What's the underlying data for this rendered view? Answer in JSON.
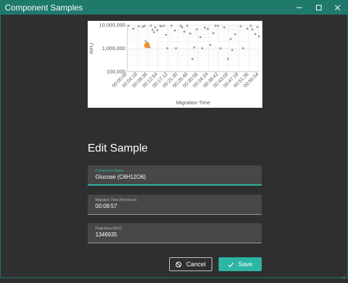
{
  "window": {
    "title": "Component Samples",
    "controls": {
      "minimize_icon": "minimize-icon",
      "maximize_icon": "maximize-icon",
      "close_icon": "close-icon"
    }
  },
  "chart_data": {
    "type": "scatter",
    "ylabel": "RFU",
    "xlabel": "Migration Time",
    "y_scale": "log",
    "ylim": [
      100,
      10000000
    ],
    "y_ticks": [
      "10,000,000",
      "1,000,000",
      "100,000"
    ],
    "x_ticks": [
      "00:00:00",
      "00:04:18",
      "00:08:36",
      "00:12:54",
      "00:17:12",
      "00:21:30",
      "00:25:48",
      "00:30:06",
      "00:34:24",
      "00:38:42",
      "00:43:00",
      "00:47:18",
      "00:51:36",
      "00:55:54"
    ],
    "xlim_seconds": [
      0,
      3600
    ],
    "grid": true,
    "series": [
      {
        "color": "#9e9e9e",
        "points": [
          {
            "x": 30,
            "y": 9800000
          },
          {
            "x": 160,
            "y": 6900000
          },
          {
            "x": 310,
            "y": 8900000
          },
          {
            "x": 420,
            "y": 8500000
          },
          {
            "x": 470,
            "y": 9200000
          },
          {
            "x": 500,
            "y": 2000000
          },
          {
            "x": 560,
            "y": 1700000
          },
          {
            "x": 610,
            "y": 1100000
          },
          {
            "x": 640,
            "y": 9400000
          },
          {
            "x": 690,
            "y": 6200000
          },
          {
            "x": 730,
            "y": 4900000
          },
          {
            "x": 760,
            "y": 8100000
          },
          {
            "x": 820,
            "y": 6000000
          },
          {
            "x": 900,
            "y": 10500000
          },
          {
            "x": 930,
            "y": 8800000
          },
          {
            "x": 1000,
            "y": 11000000
          },
          {
            "x": 1060,
            "y": 3800000
          },
          {
            "x": 1090,
            "y": 1000000
          },
          {
            "x": 1210,
            "y": 9700000
          },
          {
            "x": 1300,
            "y": 5800000
          },
          {
            "x": 1330,
            "y": 1000000
          },
          {
            "x": 1460,
            "y": 10700000
          },
          {
            "x": 1500,
            "y": 8000000
          },
          {
            "x": 1560,
            "y": 5200000
          },
          {
            "x": 1640,
            "y": 10000000
          },
          {
            "x": 1720,
            "y": 4300000
          },
          {
            "x": 1780,
            "y": 350000
          },
          {
            "x": 1830,
            "y": 1100000
          },
          {
            "x": 1900,
            "y": 6500000
          },
          {
            "x": 2000,
            "y": 3000000
          },
          {
            "x": 2050,
            "y": 1000000
          },
          {
            "x": 2120,
            "y": 7700000
          },
          {
            "x": 2200,
            "y": 6800000
          },
          {
            "x": 2270,
            "y": 1400000
          },
          {
            "x": 2350,
            "y": 4500000
          },
          {
            "x": 2410,
            "y": 10500000
          },
          {
            "x": 2480,
            "y": 9500000
          },
          {
            "x": 2550,
            "y": 1000000
          },
          {
            "x": 2650,
            "y": 8000000
          },
          {
            "x": 2750,
            "y": 350000
          },
          {
            "x": 2830,
            "y": 2500000
          },
          {
            "x": 2870,
            "y": 850000
          },
          {
            "x": 2950,
            "y": 4000000
          },
          {
            "x": 3100,
            "y": 8800000
          },
          {
            "x": 3170,
            "y": 1000000
          },
          {
            "x": 3280,
            "y": 7000000
          },
          {
            "x": 3380,
            "y": 10000000
          },
          {
            "x": 3420,
            "y": 6500000
          },
          {
            "x": 3500,
            "y": 4100000
          },
          {
            "x": 3560,
            "y": 8200000
          },
          {
            "x": 3600,
            "y": 3300000
          }
        ]
      },
      {
        "color": "#f28c1e",
        "highlighted": true,
        "points": [
          {
            "x": 537,
            "y": 1346935
          }
        ]
      }
    ]
  },
  "dialog": {
    "title": "Edit Sample",
    "fields": [
      {
        "label": "Component Name",
        "value": "Glucose (C6H12O6)"
      },
      {
        "label": "Migration Time (hh:mm:ss)",
        "value": "00:08:57"
      },
      {
        "label": "Peak Area (RFU)",
        "value": "1346935"
      }
    ],
    "buttons": {
      "cancel": {
        "label": "Cancel",
        "icon": "cancel-icon"
      },
      "save": {
        "label": "Save",
        "icon": "check-icon"
      }
    }
  },
  "colors": {
    "accent": "#2bb5a2",
    "titlebar": "#1f7a6c",
    "background": "#2f2f2f",
    "field_background": "#474747",
    "highlight_point": "#f28c1e"
  }
}
